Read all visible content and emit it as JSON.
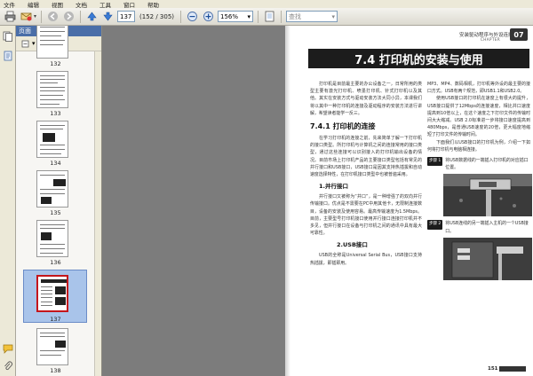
{
  "menu": {
    "items": [
      "文件",
      "编辑",
      "视图",
      "文档",
      "工具",
      "窗口",
      "帮助"
    ]
  },
  "toolbar": {
    "page_current": "137",
    "page_total": "(152 / 305)",
    "zoom": "156%",
    "find_placeholder": "查找"
  },
  "pages_panel": {
    "title": "页面",
    "options_label": "▾",
    "thumbnails": [
      {
        "label": "132",
        "selected": false
      },
      {
        "label": "133",
        "selected": false
      },
      {
        "label": "134",
        "selected": false
      },
      {
        "label": "135",
        "selected": false
      },
      {
        "label": "136",
        "selected": false
      },
      {
        "label": "137",
        "selected": true
      },
      {
        "label": "138",
        "selected": false
      }
    ]
  },
  "document": {
    "running_head": "安装驱动程序与外设连接",
    "chapter_number": "07",
    "chapter_en": "CHAPTER",
    "title": "7.4 打印机的安装与使用",
    "intro": "打印机是目前最主要的办公设备之一，日常所用的类型主要有激光打印机、喷墨打印机、针式打印机以及其他。其实在安装方式与驱动安装方法大同小异，本课我们将以其中一种打印机的连接及驱动程序的安装方法进行讲解，希望读者能学一反三。",
    "section_title": "7.4.1 打印机的连接",
    "section_text": "在学习打印机的连接之前，先来简单了解一下打印机的接口类型。所打印机与计算机之间的连接常用的接口类型，通过这些连接可以识别接入的打印机输出设备的情况。目前市场上打印机产品的主要接口类型包括有常见的并行接口和USB接口，USB接口是因其支持热插拔和自动速度选择特性，在打印机接口类型中也被普遍采用。",
    "sub1_title": "1.并行接口",
    "sub1_text": "并行接口又被称为“并口”，是一种增强了的双向并行传输接口。优点是不需要在PC中用其他卡，无限制连接数目，设备的安装及使用容易。最高传输速度为1.5Mbps。目前，主要型号打印机接口使用并行接口连接打印机并不多见，但并行接口在设备与打印机之间的通讯中具有最大可靠性。",
    "sub2_title": "2.USB接口",
    "sub2_text": "USB的全称是Universal Serial Bus，USB接口支持热插拔，即插即用。",
    "col2_text_a": "MP3、MP4、数码相机，打印机等外设的最主要的接口方式。USB有两个规范，即USB1.1和USB2.0。",
    "col2_text_b": "使用USB接口的打印机在速度上有很大的提升，USB接口提供了12Mbps的连接速度，相比并口速度提高到10倍以上，在这个速度之下打印文件的传输时间大大缩减。USB 2.0标准进一步将接口速度提高到480Mbps，是普通USB速度的20倍，更大幅度地缩短了打印文件的传输时间。",
    "col2_text_c": "下面我们以USB接口的打印机为例，介绍一下如何将打印机与电脑相连接。",
    "step1_label": "步骤 1",
    "step1_text": "将USB数据线的一端插入打印机的对应插口位置。",
    "step2_label": "步骤 2",
    "step2_text": "将USB连线的另一端插入主机的一个USB接口。",
    "page_number": "151"
  }
}
